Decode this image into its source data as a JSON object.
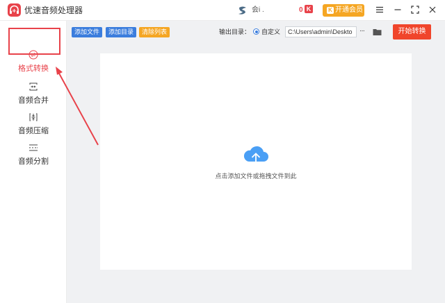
{
  "window": {
    "title": "优速音频处理器",
    "user_name": "会i .",
    "coin_count": "0",
    "coin_mark": "K",
    "vip_mark": "K",
    "vip_label": "开通会员"
  },
  "sidebar": {
    "items": [
      {
        "label": "格式转换",
        "icon": "format-convert-icon",
        "active": true
      },
      {
        "label": "音频合并",
        "icon": "audio-merge-icon",
        "active": false
      },
      {
        "label": "音频压缩",
        "icon": "audio-compress-icon",
        "active": false
      },
      {
        "label": "音频分割",
        "icon": "audio-split-icon",
        "active": false
      }
    ]
  },
  "toolbar": {
    "add_file": "添加文件",
    "add_folder": "添加目录",
    "clear_list": "清除列表",
    "output_label": "输出目录：",
    "custom_label": "自定义",
    "output_path": "C:\\Users\\admin\\Deskto",
    "more": "···",
    "start": "开始转换"
  },
  "drop_area": {
    "hint": "点击添加文件或拖拽文件到此"
  },
  "colors": {
    "accent_red": "#e8424a",
    "start_button": "#f0452b",
    "blue_button": "#3b7ddd",
    "orange_button": "#f5a623",
    "cloud_blue": "#4a9ff5"
  }
}
